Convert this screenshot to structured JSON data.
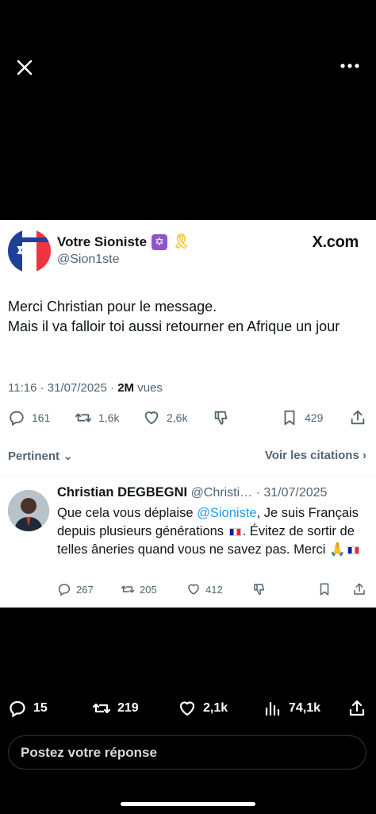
{
  "top_bar": {
    "close_icon": "close-icon",
    "more_icon": "more-horizontal-icon"
  },
  "tweet": {
    "author_name": "Votre Sioniste",
    "author_badge": "✡",
    "author_ribbon": "🎗",
    "author_handle": "@Sion1ste",
    "source_label": "X.com",
    "text_line1": "Merci Christian pour le message.",
    "text_line2": "Mais il va falloir toi aussi retourner en Afrique un jour",
    "time": "11:16",
    "date": "31/07/2025",
    "views_count": "2M",
    "views_label": "vues",
    "replies": "161",
    "retweets": "1,6k",
    "likes": "2,6k",
    "bookmarks": "429"
  },
  "sort": {
    "left_label": "Pertinent",
    "right_label": "Voir les citations"
  },
  "reply": {
    "author_name": "Christian DEGBEGNI",
    "author_handle": "@Christi…",
    "date": "31/07/2025",
    "text_a": "Que cela vous déplaise ",
    "mention": "@Sioniste",
    "text_b": ", Je suis Français depuis plusieurs générations ",
    "text_c": ". Évitez de sortir de telles âneries quand vous ne savez pas. Merci ",
    "pray": "🙏",
    "replies": "267",
    "retweets": "205",
    "likes": "412"
  },
  "bottom": {
    "replies": "15",
    "retweets": "219",
    "likes": "2,1k",
    "views": "74,1k",
    "reply_placeholder": "Postez votre réponse"
  },
  "colors": {
    "accent": "#1d9bf0",
    "background": "#000000",
    "card": "#ffffff",
    "muted": "#536471"
  }
}
